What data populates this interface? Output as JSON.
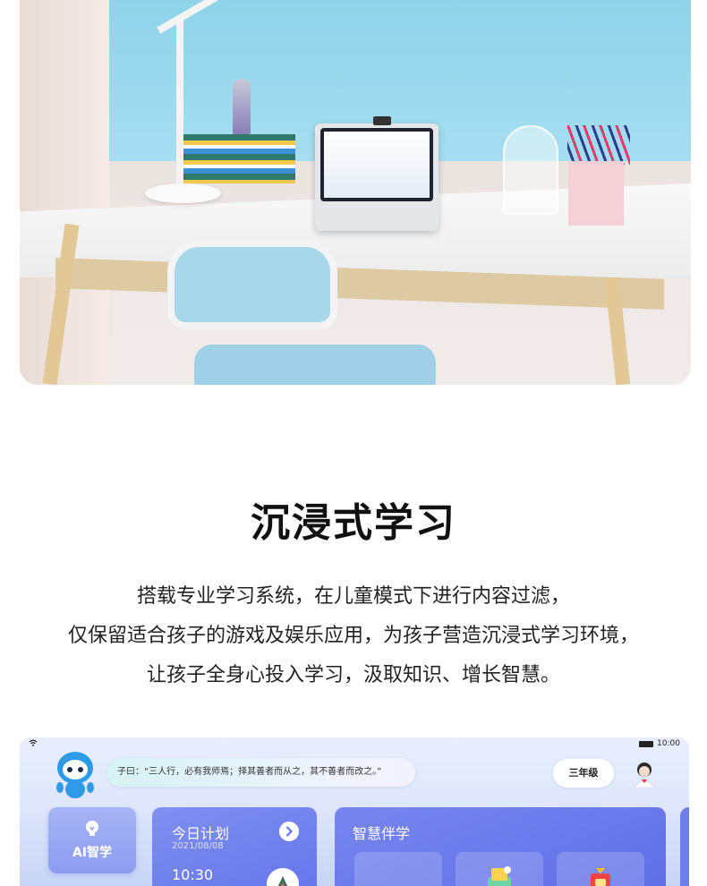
{
  "section": {
    "title": "沉浸式学习",
    "description_lines": [
      "搭载专业学习系统，在儿童模式下进行内容过滤，",
      "仅保留适合孩子的游戏及娱乐应用，为孩子营造沉浸式学习环境，",
      "让孩子全身心投入学习，汲取知识、增长智慧。"
    ]
  },
  "tablet_ui": {
    "status_bar": {
      "time": "10:00"
    },
    "quote": "子曰：“三人行，必有我师焉；择其善者而从之，其不善者而改之。”",
    "grade_button": "三年级",
    "ai_card": {
      "label": "AI智学",
      "icon": "lightbulb-icon"
    },
    "plan_card": {
      "title": "今日计划",
      "date": "2021/08/08",
      "time": "10:30"
    },
    "companion_card": {
      "title": "智慧伴学"
    },
    "colors": {
      "accent": "#6374ea",
      "background": "#dfe7fb"
    }
  }
}
